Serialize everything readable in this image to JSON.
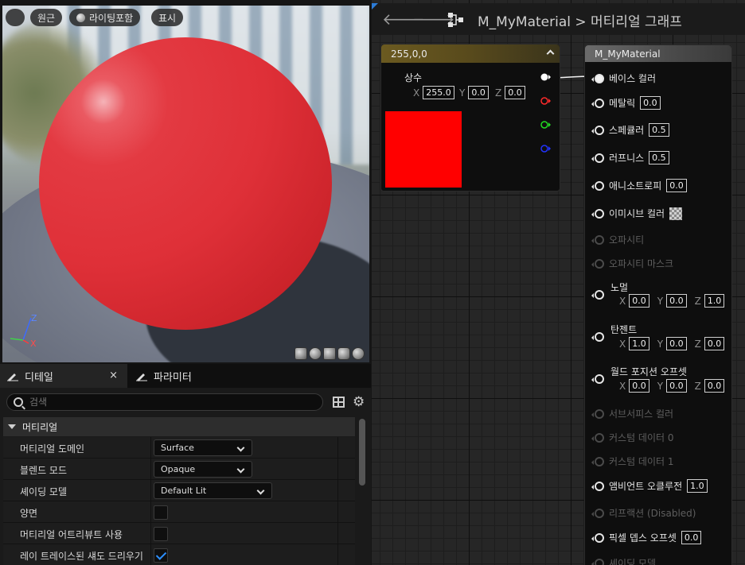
{
  "viewport": {
    "buttons": {
      "view_mode": "원근",
      "lighting": "라이팅포함",
      "show": "표시"
    },
    "axis": {
      "z": "Z",
      "x": "X"
    }
  },
  "tabs": {
    "details": "디테일",
    "close": "×",
    "parameters": "파라미터"
  },
  "details": {
    "search_placeholder": "검색",
    "section_title": "머티리얼",
    "properties": [
      {
        "label": "머티리얼 도메인",
        "type": "dropdown",
        "value": "Surface"
      },
      {
        "label": "블렌드 모드",
        "type": "dropdown",
        "value": "Opaque"
      },
      {
        "label": "셰이딩 모델",
        "type": "dropdown",
        "value": "Default Lit"
      },
      {
        "label": "양면",
        "type": "checkbox",
        "checked": false
      },
      {
        "label": "머티리얼 어트리뷰트 사용",
        "type": "checkbox",
        "checked": false
      },
      {
        "label": "레이 트레이스된 섀도 드리우기",
        "type": "checkbox",
        "checked": true
      }
    ]
  },
  "graph": {
    "back_arrow": "🡐",
    "forward_arrow": "🡒",
    "breadcrumb": {
      "asset": "M_MyMaterial",
      "separator": ">",
      "graph": "머티리얼 그래프"
    },
    "constant_node": {
      "title": "255,0,0",
      "label": "상수",
      "x_label": "X",
      "x": "255.0",
      "y_label": "Y",
      "y": "0.0",
      "z_label": "Z",
      "z": "0.0",
      "color": "#ff0000",
      "pin_colors": [
        "#ffffff",
        "#ff2a2a",
        "#22dd22",
        "#2233ff"
      ]
    },
    "result_node": {
      "title": "M_MyMaterial",
      "pins": [
        {
          "label": "베이스 컬러",
          "state": "connected"
        },
        {
          "label": "메탈릭",
          "value": "0.0"
        },
        {
          "label": "스페큘러",
          "value": "0.5"
        },
        {
          "label": "러프니스",
          "value": "0.5"
        },
        {
          "label": "애니소트로피",
          "value": "0.0"
        },
        {
          "label": "이미시브 컬러",
          "value_icon": "checker-icon"
        },
        {
          "label": "오파시티",
          "state": "disabled"
        },
        {
          "label": "오파시티 마스크",
          "state": "disabled"
        },
        {
          "label": "노멀",
          "x_label": "X",
          "x": "0.0",
          "y_label": "Y",
          "y": "0.0",
          "z_label": "Z",
          "z": "1.0"
        },
        {
          "label": "탄젠트",
          "x_label": "X",
          "x": "1.0",
          "y_label": "Y",
          "y": "0.0",
          "z_label": "Z",
          "z": "0.0"
        },
        {
          "label": "월드 포지션 오프셋",
          "x_label": "X",
          "x": "0.0",
          "y_label": "Y",
          "y": "0.0",
          "z_label": "Z",
          "z": "0.0"
        },
        {
          "label": "서브서피스 컬러",
          "state": "disabled"
        },
        {
          "label": "커스텀 데이터 0",
          "state": "disabled"
        },
        {
          "label": "커스텀 데이터 1",
          "state": "disabled"
        },
        {
          "label": "앰비언트 오클루전",
          "value": "1.0"
        },
        {
          "label": "리프랙션 (Disabled)",
          "state": "disabled"
        },
        {
          "label": "픽셀 뎁스 오프셋",
          "value": "0.0"
        },
        {
          "label": "셰이딩 모델",
          "state": "disabled"
        }
      ]
    }
  }
}
